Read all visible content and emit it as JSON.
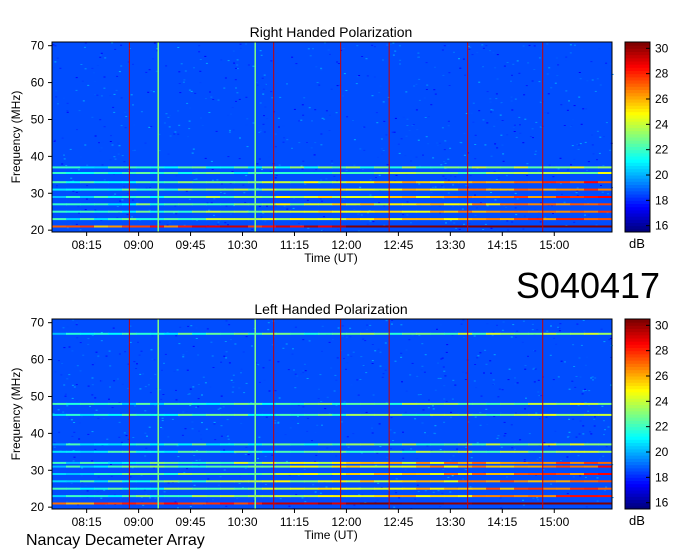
{
  "figure": {
    "observation_id": "S040417",
    "footer": "Nancay Decameter Array"
  },
  "chart_data": [
    {
      "type": "heatmap",
      "title": "Right Handed Polarization",
      "xlabel": "Time (UT)",
      "ylabel": "Frequency (MHz)",
      "xlim": [
        "07:45",
        "15:50"
      ],
      "ylim": [
        19.5,
        71
      ],
      "x_ticks": [
        "08:15",
        "09:00",
        "09:45",
        "10:30",
        "11:15",
        "12:00",
        "12:45",
        "13:30",
        "14:15",
        "15:00"
      ],
      "y_ticks": [
        20,
        30,
        40,
        50,
        60,
        70
      ],
      "colorbar": {
        "label": "dB",
        "range": [
          15.5,
          30.5
        ],
        "ticks": [
          16,
          18,
          20,
          22,
          24,
          26,
          28,
          30
        ],
        "colormap": "jet"
      },
      "marker_lines_ut": [
        "08:52",
        "10:57",
        "11:55",
        "12:37",
        "13:45",
        "14:50"
      ],
      "marker_line_color": "#cc0000",
      "bright_vertical_lines_ut": [
        "09:17",
        "10:41"
      ],
      "interference_bands_mhz": [
        21,
        23,
        25,
        27,
        29,
        31,
        33,
        35.5,
        37
      ]
    },
    {
      "type": "heatmap",
      "title": "Left Handed Polarization",
      "xlabel": "Time (UT)",
      "ylabel": "Frequency (MHz)",
      "xlim": [
        "07:45",
        "15:50"
      ],
      "ylim": [
        19.5,
        71
      ],
      "x_ticks": [
        "08:15",
        "09:00",
        "09:45",
        "10:30",
        "11:15",
        "12:00",
        "12:45",
        "13:30",
        "14:15",
        "15:00"
      ],
      "y_ticks": [
        20,
        30,
        40,
        50,
        60,
        70
      ],
      "colorbar": {
        "label": "dB",
        "range": [
          15.5,
          30.5
        ],
        "ticks": [
          16,
          18,
          20,
          22,
          24,
          26,
          28,
          30
        ],
        "colormap": "jet"
      },
      "marker_lines_ut": [
        "08:52",
        "10:57",
        "11:55",
        "12:37",
        "13:45",
        "14:50"
      ],
      "marker_line_color": "#cc0000",
      "bright_vertical_lines_ut": [
        "09:17",
        "10:41"
      ],
      "interference_bands_mhz": [
        21,
        23,
        25,
        27,
        29,
        31,
        32,
        35,
        37,
        45,
        48,
        67
      ]
    }
  ]
}
